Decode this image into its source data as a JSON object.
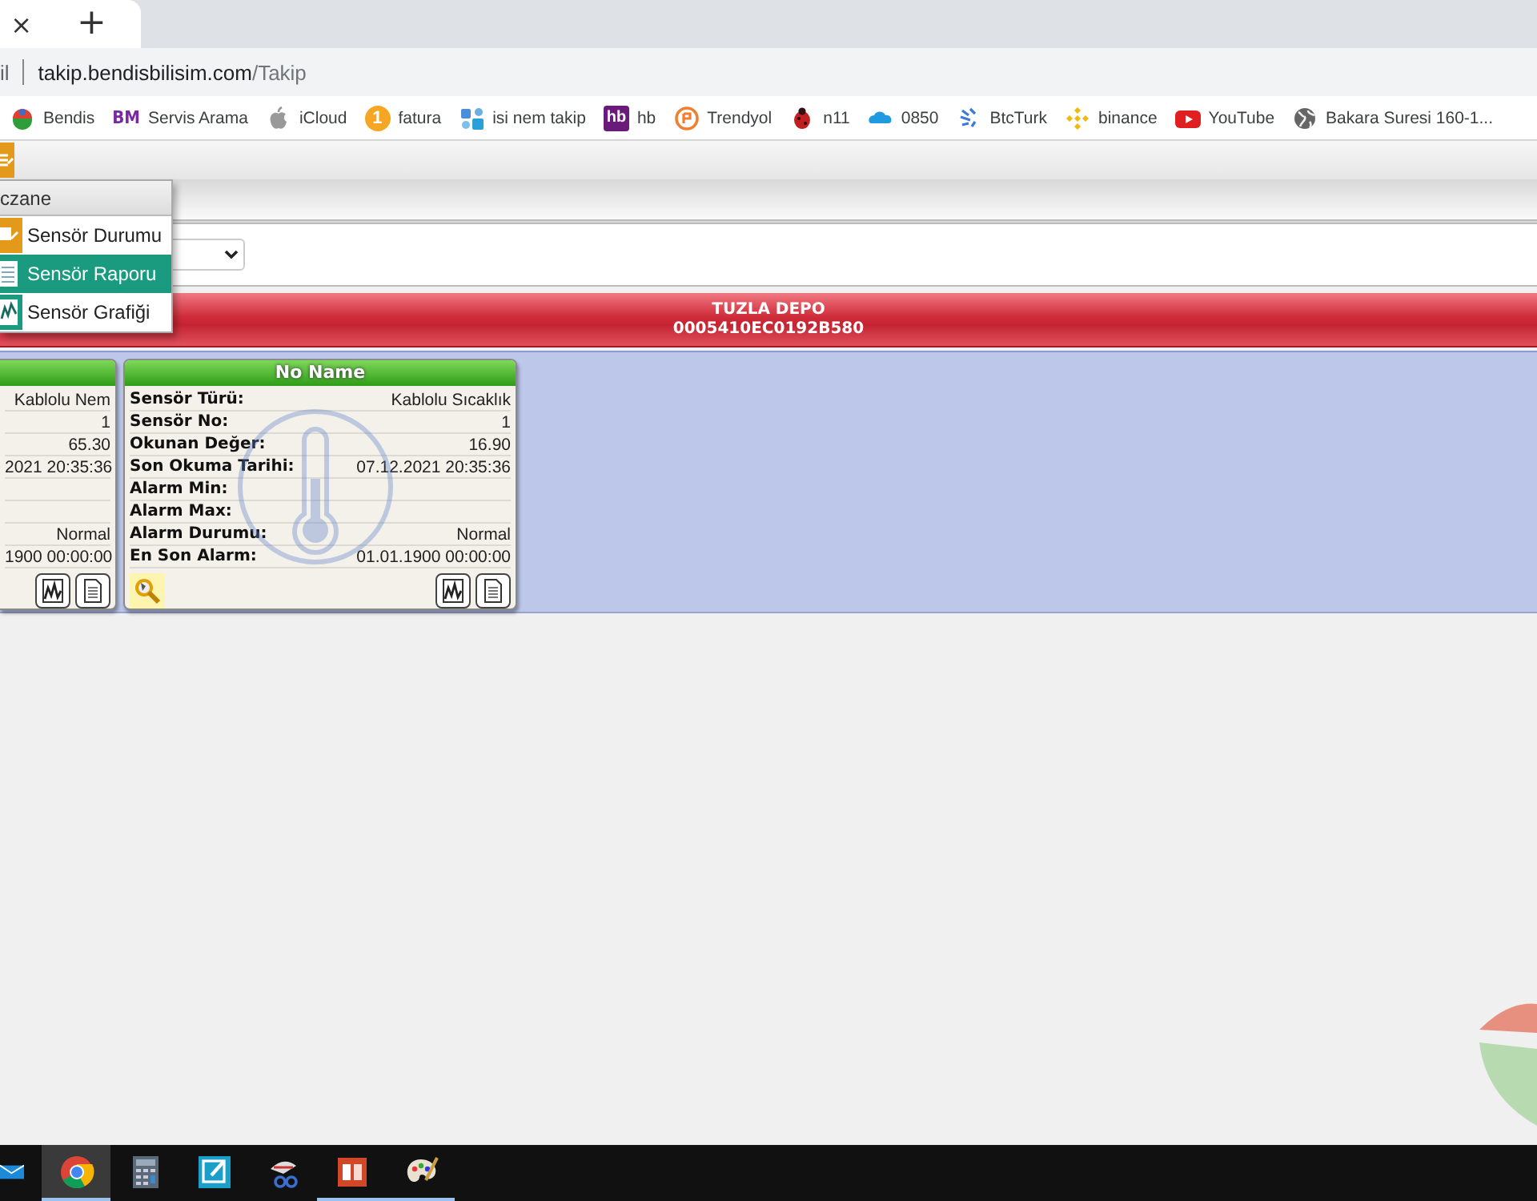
{
  "browser": {
    "tab": {
      "close": "×"
    },
    "new_tab": "+",
    "address": {
      "prefix": "il",
      "host": "takip.bendisbilisim.com",
      "path": "/Takip"
    },
    "bookmarks": [
      {
        "label": "Bendis"
      },
      {
        "label": "Servis Arama",
        "badge": "BM"
      },
      {
        "label": "iCloud"
      },
      {
        "label": "fatura",
        "badge": "1"
      },
      {
        "label": "isi nem takip"
      },
      {
        "label": "hb",
        "badge": "hb"
      },
      {
        "label": "Trendyol"
      },
      {
        "label": "n11"
      },
      {
        "label": "0850"
      },
      {
        "label": "BtcTurk"
      },
      {
        "label": "binance"
      },
      {
        "label": "YouTube"
      },
      {
        "label": "Bakara Suresi 160-1..."
      }
    ]
  },
  "app": {
    "menu": {
      "header": "czane",
      "items": [
        {
          "label": "Sensör Durumu",
          "selected": false
        },
        {
          "label": "Sensör Raporu",
          "selected": true
        },
        {
          "label": "Sensör Grafiği",
          "selected": false
        }
      ]
    },
    "location": {
      "name": "TUZLA DEPO",
      "id": "0005410EC0192B580"
    },
    "sensors": [
      {
        "kind": "partial",
        "rows": [
          {
            "value": "Kablolu Nem"
          },
          {
            "value": "1"
          },
          {
            "value": "65.30"
          },
          {
            "value": "2021 20:35:36"
          },
          {},
          {},
          {
            "value": "Normal"
          },
          {
            "value": "1900 00:00:00"
          }
        ]
      },
      {
        "kind": "full",
        "title": "No Name",
        "search_button": true,
        "rows": [
          {
            "label": "Sensör Türü:",
            "value": "Kablolu Sıcaklık"
          },
          {
            "label": "Sensör No:",
            "value": "1"
          },
          {
            "label": "Okunan Değer:",
            "value": "16.90"
          },
          {
            "label": "Son Okuma Tarihi:",
            "value": "07.12.2021 20:35:36"
          },
          {
            "label": "Alarm Min:"
          },
          {
            "label": "Alarm Max:"
          },
          {
            "label": "Alarm Durumu:",
            "value": "Normal"
          },
          {
            "label": "En Son Alarm:",
            "value": "01.01.1900 00:00:00"
          }
        ]
      }
    ]
  },
  "taskbar": {
    "apps": [
      {
        "running": false,
        "active": false
      },
      {
        "running": true,
        "active": true
      },
      {
        "running": false,
        "active": false
      },
      {
        "running": false,
        "active": false
      },
      {
        "running": false,
        "active": false
      },
      {
        "running": true,
        "active": false
      },
      {
        "running": true,
        "active": false
      }
    ]
  }
}
